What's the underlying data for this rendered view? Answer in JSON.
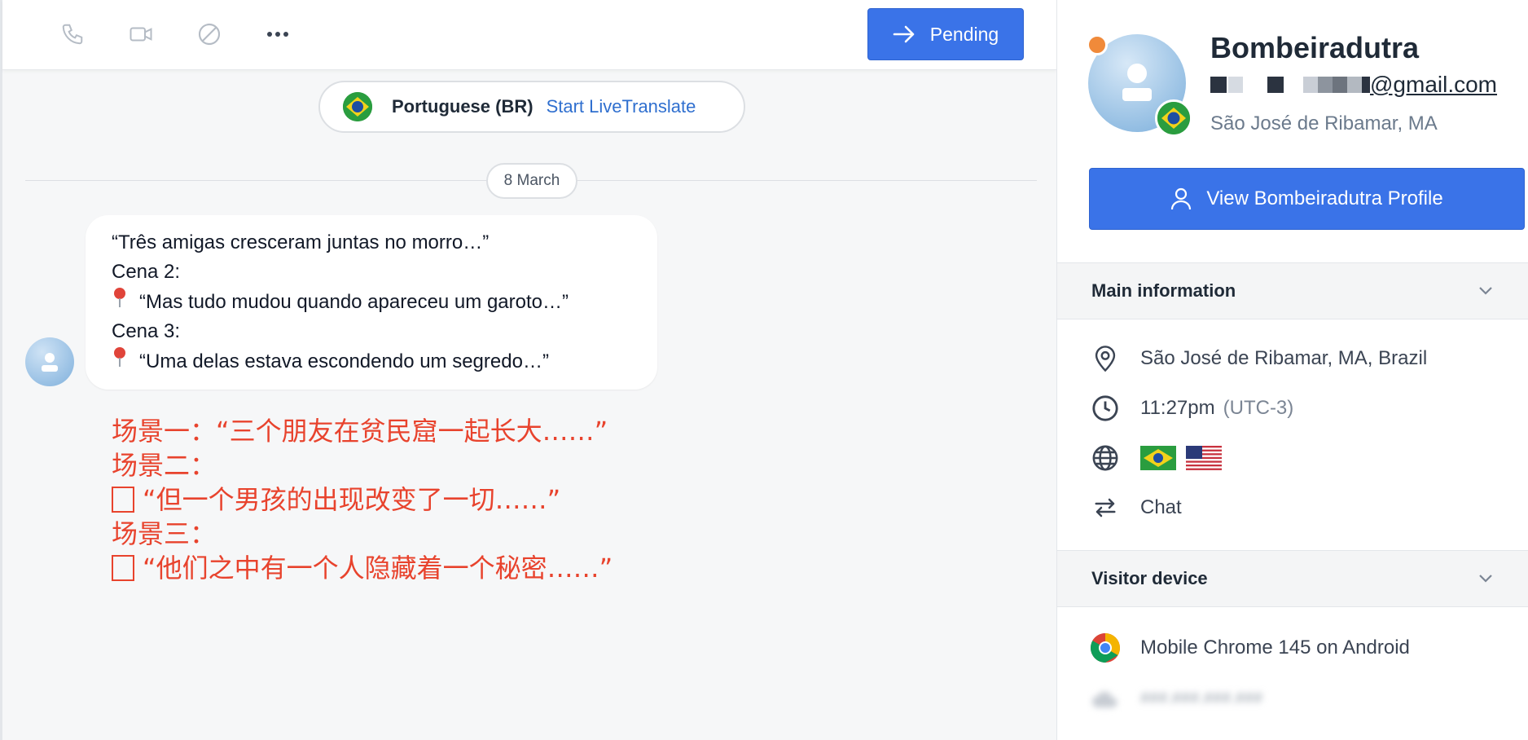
{
  "toolbar": {
    "icons": [
      "phone-icon",
      "video-icon",
      "block-icon",
      "more-icon"
    ],
    "pending_label": "Pending"
  },
  "language": {
    "name": "Portuguese (BR)",
    "action": "Start LiveTranslate"
  },
  "date_divider": "8 March",
  "message": {
    "lines": [
      {
        "pin": false,
        "text": "“Três amigas cresceram juntas no morro…”"
      },
      {
        "pin": false,
        "text": "Cena 2:"
      },
      {
        "pin": true,
        "text": "“Mas tudo mudou quando apareceu um garoto…”"
      },
      {
        "pin": false,
        "text": "Cena 3:"
      },
      {
        "pin": true,
        "text": "“Uma delas estava escondendo um segredo…”"
      }
    ]
  },
  "translation": {
    "lines": [
      {
        "box": false,
        "text": "场景一：“三个朋友在贫民窟一起长大……”"
      },
      {
        "box": false,
        "text": "场景二："
      },
      {
        "box": true,
        "text": "“但一个男孩的出现改变了一切……”"
      },
      {
        "box": false,
        "text": "场景三："
      },
      {
        "box": true,
        "text": "“他们之中有一个人隐藏着一个秘密……”"
      }
    ],
    "color": "#e8432d"
  },
  "profile": {
    "name": "Bombeiradutra",
    "email_domain": "@gmail.com",
    "location": "São José de Ribamar, MA",
    "status_color": "#f08a3a",
    "view_button": "View Bombeiradutra Profile"
  },
  "main_info": {
    "header": "Main information",
    "location": "São José de Ribamar, MA, Brazil",
    "local_time": "11:27pm",
    "timezone": "(UTC-3)",
    "channel": "Chat"
  },
  "visitor_device": {
    "header": "Visitor device",
    "browser": "Mobile Chrome 145 on Android",
    "ip": "###.###.###.###"
  },
  "colors": {
    "accent": "#3a73e8",
    "link": "#2f6fcf"
  }
}
